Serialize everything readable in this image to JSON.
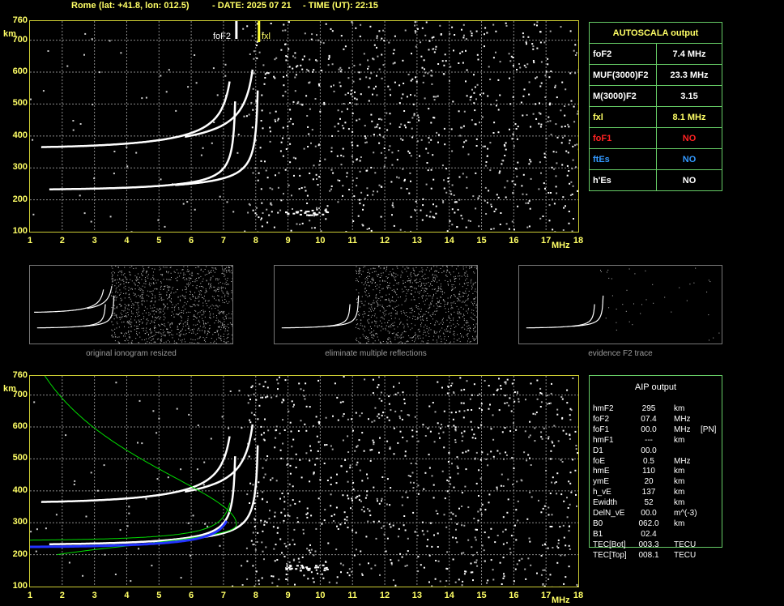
{
  "header": {
    "station": "Rome",
    "coords": "(lat: +41.8, lon: 012.5)",
    "date": "- DATE: 2025 07 21",
    "time": "- TIME (UT): 22:15"
  },
  "main_plot": {
    "y_ticks": [
      "760",
      "700",
      "600",
      "500",
      "400",
      "300",
      "200",
      "100"
    ],
    "y_unit": "km",
    "x_ticks": [
      "1",
      "2",
      "3",
      "4",
      "5",
      "6",
      "7",
      "8",
      "9",
      "10",
      "11",
      "12",
      "13",
      "14",
      "15",
      "16",
      "17",
      "18"
    ],
    "x_unit": "MHz",
    "label_foF2": "foF2",
    "label_fxl": "fxl"
  },
  "autoscala": {
    "title": "AUTOSCALA output",
    "rows": [
      {
        "label": "foF2",
        "value": "7.4 MHz",
        "color": "#ffffff"
      },
      {
        "label": "MUF(3000)F2",
        "value": "23.3 MHz",
        "color": "#ffffff"
      },
      {
        "label": "M(3000)F2",
        "value": "3.15",
        "color": "#ffffff"
      },
      {
        "label": "fxl",
        "value": "8.1 MHz",
        "color": "#ffff66"
      },
      {
        "label": "foF1",
        "value": "NO",
        "color": "#ff2222"
      },
      {
        "label": "ftEs",
        "value": "NO",
        "color": "#3399ff"
      },
      {
        "label": "h'Es",
        "value": "NO",
        "color": "#ffffff"
      }
    ]
  },
  "thumbnails": [
    {
      "caption": "original ionogram resized"
    },
    {
      "caption": "eliminate multiple reflections"
    },
    {
      "caption": "evidence F2 trace"
    }
  ],
  "aip": {
    "title": "AIP output",
    "rows": [
      {
        "name": "hmF2",
        "value": "295",
        "unit": "km",
        "extra": ""
      },
      {
        "name": "foF2",
        "value": "07.4",
        "unit": "MHz",
        "extra": ""
      },
      {
        "name": "foF1",
        "value": "00.0",
        "unit": "MHz",
        "extra": "[PN]"
      },
      {
        "name": "hmF1",
        "value": "---",
        "unit": "km",
        "extra": ""
      },
      {
        "name": "D1",
        "value": "00.0",
        "unit": "",
        "extra": ""
      },
      {
        "name": "foE",
        "value": "0.5",
        "unit": "MHz",
        "extra": ""
      },
      {
        "name": "hmE",
        "value": "110",
        "unit": "km",
        "extra": ""
      },
      {
        "name": "ymE",
        "value": "20",
        "unit": "km",
        "extra": ""
      },
      {
        "name": "h_vE",
        "value": "137",
        "unit": "km",
        "extra": ""
      },
      {
        "name": "Ewidth",
        "value": "52",
        "unit": "km",
        "extra": ""
      },
      {
        "name": "DelN_vE",
        "value": "00.0",
        "unit": "m^(-3)",
        "extra": ""
      },
      {
        "name": "B0",
        "value": "062.0",
        "unit": "km",
        "extra": ""
      },
      {
        "name": "B1",
        "value": "02.4",
        "unit": "",
        "extra": ""
      },
      {
        "name": "TEC[Bot]",
        "value": "003.3",
        "unit": "TECU",
        "extra": ""
      },
      {
        "name": "TEC[Top]",
        "value": "008.1",
        "unit": "TECU",
        "extra": ""
      }
    ]
  },
  "colors": {
    "axis": "#ffff66",
    "frame": "#cccc33",
    "grid": "#8a8a8a",
    "trace": "#ffffff",
    "profile": "#00dd00",
    "fit": "#2233ff",
    "table_border": "#66cc66"
  }
}
